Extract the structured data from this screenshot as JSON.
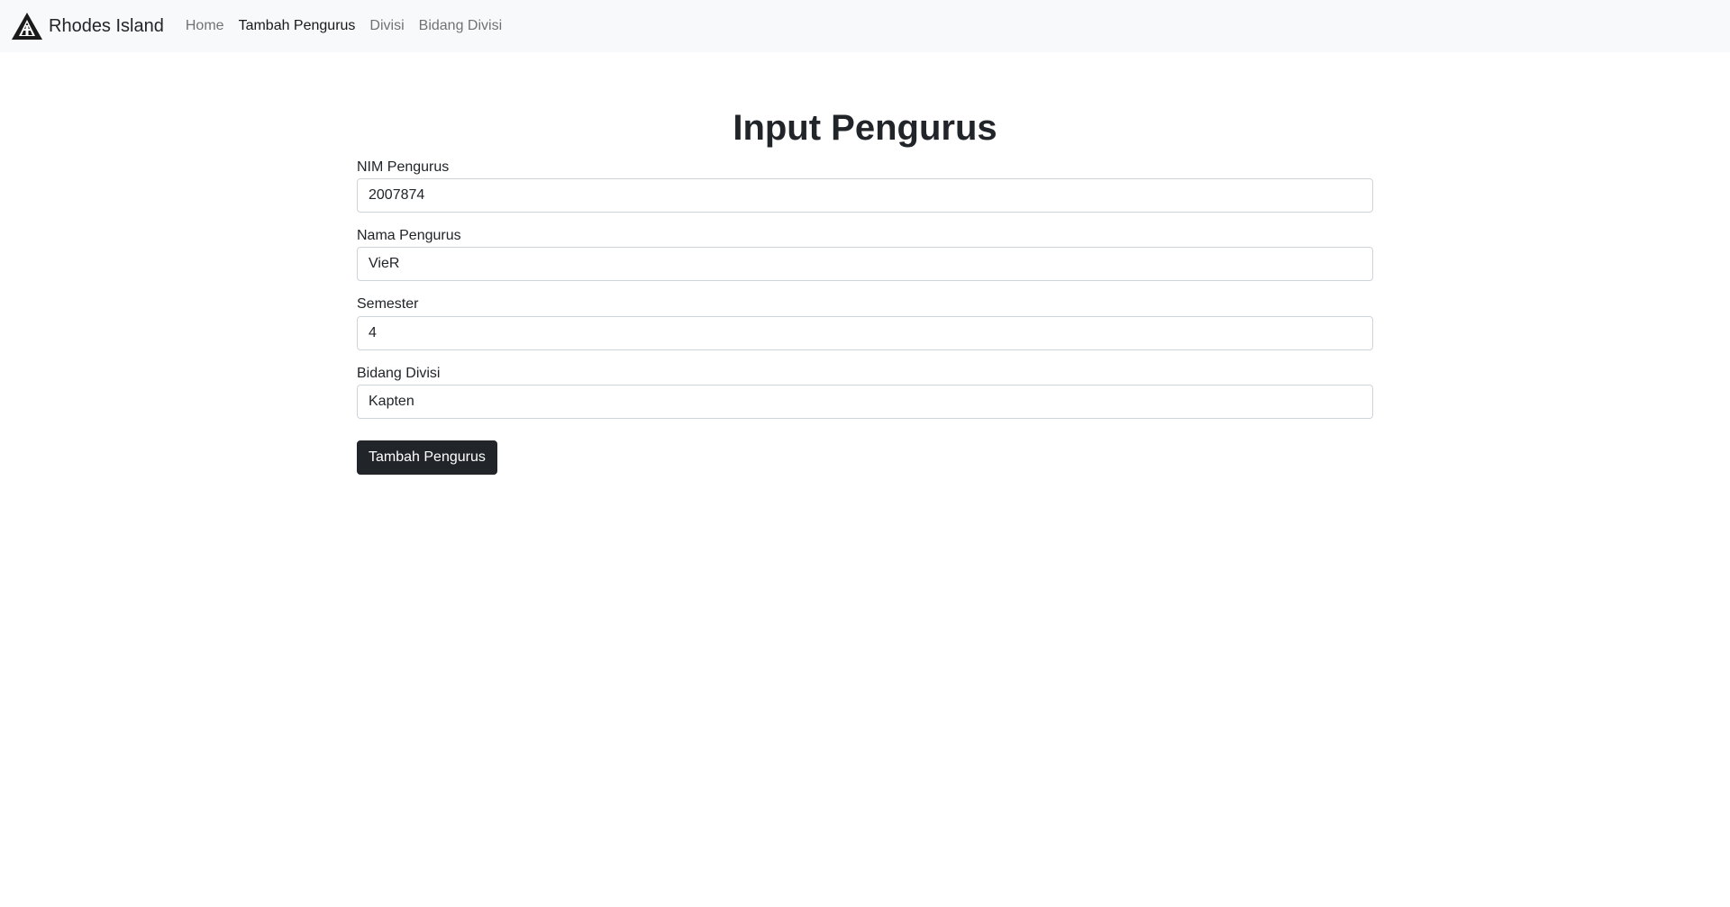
{
  "navbar": {
    "brand_name": "Rhodes Island",
    "brand_icon": "rhodes-island-logo-icon",
    "links": [
      {
        "label": "Home",
        "active": false
      },
      {
        "label": "Tambah Pengurus",
        "active": true
      },
      {
        "label": "Divisi",
        "active": false
      },
      {
        "label": "Bidang Divisi",
        "active": false
      }
    ]
  },
  "page": {
    "title": "Input Pengurus"
  },
  "form": {
    "fields": [
      {
        "label": "NIM Pengurus",
        "value": "2007874"
      },
      {
        "label": "Nama Pengurus",
        "value": "VieR"
      },
      {
        "label": "Semester",
        "value": "4"
      },
      {
        "label": "Bidang Divisi",
        "value": "Kapten"
      }
    ],
    "submit_label": "Tambah Pengurus"
  },
  "colors": {
    "navbar_bg": "#f8f9fa",
    "button_bg": "#212529",
    "text": "#212529"
  }
}
